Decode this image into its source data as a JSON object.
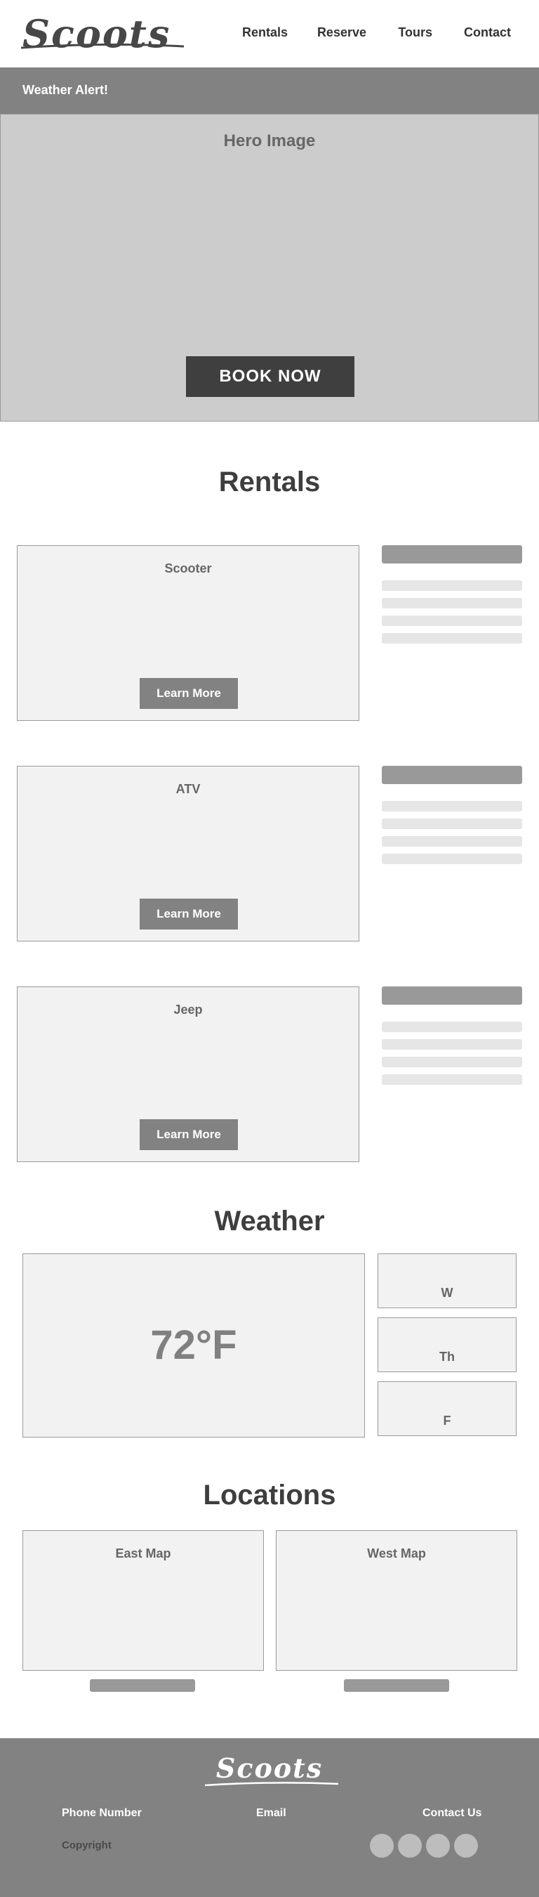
{
  "header": {
    "logo_text": "Scoots",
    "nav": [
      {
        "label": "Rentals"
      },
      {
        "label": "Reserve"
      },
      {
        "label": "Tours"
      },
      {
        "label": "Contact"
      }
    ]
  },
  "alert": {
    "text": "Weather Alert!"
  },
  "hero": {
    "image_label": "Hero Image",
    "cta_label": "BOOK NOW"
  },
  "rentals": {
    "title": "Rentals",
    "items": [
      {
        "name": "Scooter",
        "button_label": "Learn More"
      },
      {
        "name": "ATV",
        "button_label": "Learn More"
      },
      {
        "name": "Jeep",
        "button_label": "Learn More"
      }
    ]
  },
  "weather": {
    "title": "Weather",
    "current_temp": "72°F",
    "days": [
      "W",
      "Th",
      "F"
    ]
  },
  "locations": {
    "title": "Locations",
    "maps": [
      {
        "label": "East Map"
      },
      {
        "label": "West Map"
      }
    ]
  },
  "footer": {
    "logo_text": "Scoots",
    "phone_label": "Phone Number",
    "email_label": "Email",
    "contact_label": "Contact Us",
    "copyright": "Copyright"
  },
  "colors": {
    "alert_bar": "#828282",
    "hero_bg": "#cccccc",
    "cta_bg": "#3f3f3f",
    "card_bg": "#f2f2f2",
    "footer_bg": "#828282"
  }
}
